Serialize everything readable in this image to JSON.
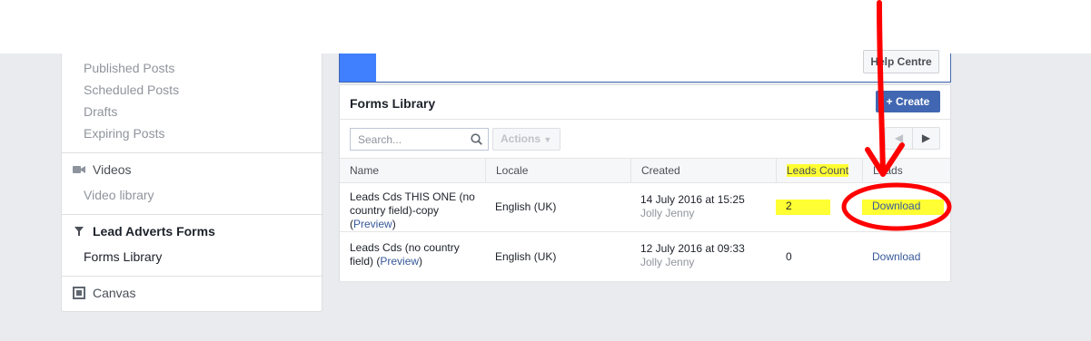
{
  "sidebar": {
    "posts": [
      "Published Posts",
      "Scheduled Posts",
      "Drafts",
      "Expiring Posts"
    ],
    "videos_label": "Videos",
    "video_library": "Video library",
    "lead_forms_label": "Lead Adverts Forms",
    "forms_library": "Forms Library",
    "canvas_label": "Canvas"
  },
  "header": {
    "help_label": "Help Centre"
  },
  "forms": {
    "title": "Forms Library",
    "create_label": "+ Create",
    "search_placeholder": "Search...",
    "actions_label": "Actions",
    "columns": [
      "Name",
      "Locale",
      "Created",
      "Leads Count",
      "Leads"
    ],
    "rows": [
      {
        "name": "Leads Cds THIS ONE (no country field)-copy",
        "preview": "Preview",
        "locale": "English (UK)",
        "created": "14 July 2016 at 15:25",
        "author": "Jolly Jenny",
        "leads_count": "2",
        "download": "Download"
      },
      {
        "name": "Leads Cds (no country field)",
        "preview": "Preview",
        "locale": "English (UK)",
        "created": "12 July 2016 at 09:33",
        "author": "Jolly Jenny",
        "leads_count": "0",
        "download": "Download"
      }
    ]
  },
  "colors": {
    "annotation": "#ff0000",
    "highlight": "#ffff33",
    "brand": "#4267b2"
  }
}
